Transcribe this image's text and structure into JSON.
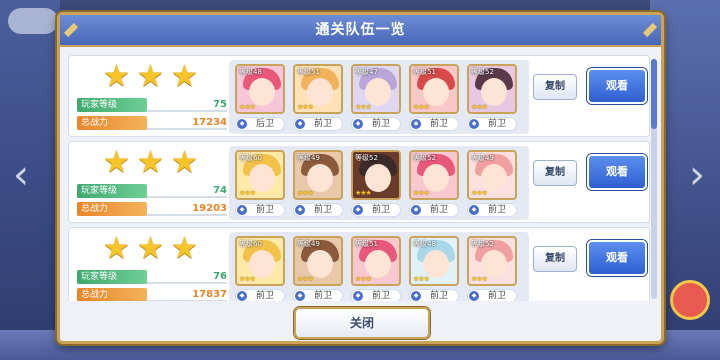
{
  "modal": {
    "title": "通关队伍一览",
    "close_label": "关闭"
  },
  "labels": {
    "player_level": "玩家等级",
    "total_power": "总战力",
    "copy": "复制",
    "view": "观看"
  },
  "teams": [
    {
      "stars": 3,
      "player_level": "75",
      "total_power": "17234",
      "units": [
        {
          "level": "等级48",
          "stars": "★★★",
          "position": "后卫",
          "hair_color": "#e8587a",
          "bg": "#f6c6d8"
        },
        {
          "level": "等级51",
          "stars": "★★★",
          "position": "前卫",
          "hair_color": "#f0b25a",
          "bg": "#ffe2b8"
        },
        {
          "level": "等级47",
          "stars": "★★★",
          "position": "前卫",
          "hair_color": "#b9a6d8",
          "bg": "#e0d8f2"
        },
        {
          "level": "等级51",
          "stars": "★★★",
          "position": "前卫",
          "hair_color": "#d84a4a",
          "bg": "#f8c8c8"
        },
        {
          "level": "等级52",
          "stars": "★★★",
          "position": "前卫",
          "hair_color": "#5a3a4a",
          "bg": "#e8c8e0"
        }
      ]
    },
    {
      "stars": 3,
      "player_level": "74",
      "total_power": "19203",
      "units": [
        {
          "level": "等级60",
          "stars": "★★★",
          "position": "前卫",
          "hair_color": "#f2c14a",
          "bg": "#ffe9a8"
        },
        {
          "level": "等级49",
          "stars": "★★★",
          "position": "前卫",
          "hair_color": "#8a5a3a",
          "bg": "#e8c8a8"
        },
        {
          "level": "等级52",
          "stars": "★★★",
          "position": "前卫",
          "hair_color": "#3a2a2a",
          "bg": "#6a3a2a"
        },
        {
          "level": "等级52",
          "stars": "★★★",
          "position": "前卫",
          "hair_color": "#e8587a",
          "bg": "#f8c8d0"
        },
        {
          "level": "等级49",
          "stars": "★★★",
          "position": "前卫",
          "hair_color": "#f0a0a0",
          "bg": "#fbe0e0"
        }
      ]
    },
    {
      "stars": 3,
      "player_level": "76",
      "total_power": "17837",
      "units": [
        {
          "level": "等级60",
          "stars": "★★★",
          "position": "前卫",
          "hair_color": "#f2c14a",
          "bg": "#ffe9a8"
        },
        {
          "level": "等级49",
          "stars": "★★★",
          "position": "前卫",
          "hair_color": "#8a5a3a",
          "bg": "#e8c8a8"
        },
        {
          "level": "等级51",
          "stars": "★★★",
          "position": "前卫",
          "hair_color": "#e8587a",
          "bg": "#f8c8d0"
        },
        {
          "level": "等级48",
          "stars": "★★★",
          "position": "前卫",
          "hair_color": "#a8d8e8",
          "bg": "#e0f2f8"
        },
        {
          "level": "等级52",
          "stars": "★★★",
          "position": "前卫",
          "hair_color": "#f0a0a0",
          "bg": "#fbe0e0"
        }
      ]
    }
  ],
  "colors": {
    "header_blue": "#4766b8",
    "gold_border": "#c9a35a",
    "view_button": "#2f5fd0",
    "star": "#f7c52a"
  }
}
